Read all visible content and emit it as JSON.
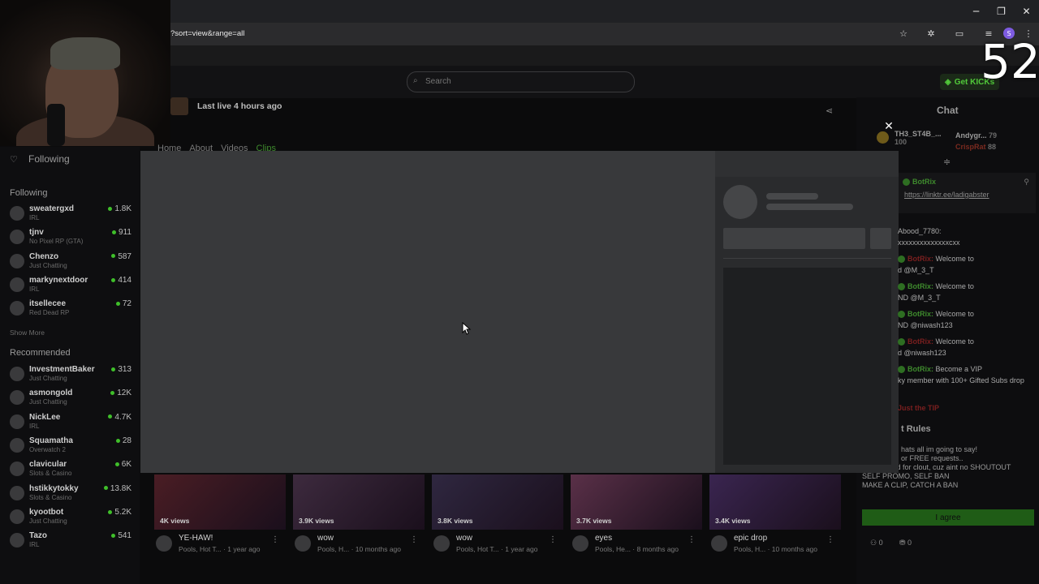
{
  "browser": {
    "url": "?sort=view&range=all",
    "profile_initial": "S",
    "win_minimize": "─",
    "win_restore": "❐",
    "win_close": "✕"
  },
  "overlay": {
    "viewer_number": "52"
  },
  "header": {
    "search_placeholder": "Search",
    "get_kicks_label": "Get KICKs"
  },
  "sidebar": {
    "following_title": "Following",
    "following_section": "Following",
    "following": [
      {
        "name": "sweatergxd",
        "category": "IRL",
        "viewers": "1.8K"
      },
      {
        "name": "tjnv",
        "category": "No Pixel RP (GTA)",
        "viewers": "911"
      },
      {
        "name": "Chenzo",
        "category": "Just Chatting",
        "viewers": "587"
      },
      {
        "name": "markynextdoor",
        "category": "IRL",
        "viewers": "414"
      },
      {
        "name": "itsellecee",
        "category": "Red Dead RP",
        "viewers": "72"
      }
    ],
    "show_more": "Show More",
    "recommended_section": "Recommended",
    "recommended": [
      {
        "name": "InvestmentBaker",
        "category": "Just Chatting",
        "viewers": "313"
      },
      {
        "name": "asmongold",
        "category": "Just Chatting",
        "viewers": "12K"
      },
      {
        "name": "NickLee",
        "category": "IRL",
        "viewers": "4.7K"
      },
      {
        "name": "Squamatha",
        "category": "Overwatch 2",
        "viewers": "28"
      },
      {
        "name": "clavicular",
        "category": "Slots & Casino",
        "viewers": "6K"
      },
      {
        "name": "hstikkytokky",
        "category": "Slots & Casino",
        "viewers": "13.8K"
      },
      {
        "name": "kyootbot",
        "category": "Just Chatting",
        "viewers": "5.2K"
      },
      {
        "name": "Tazo",
        "category": "IRL",
        "viewers": "541"
      }
    ]
  },
  "channel": {
    "last_live": "Last live 4 hours ago",
    "tabs": [
      "Home",
      "About",
      "Videos",
      "Clips"
    ],
    "active_tab": "Clips"
  },
  "clips": [
    {
      "views": "4K views",
      "title": "YE-HAW!",
      "sub": "Pools, Hot T... · 1 year ago",
      "color": "#4a1d24"
    },
    {
      "views": "3.9K views",
      "title": "wow",
      "sub": "Pools, H... · 10 months ago",
      "color": "#3d2a3e"
    },
    {
      "views": "3.8K views",
      "title": "wow",
      "sub": "Pools, Hot T... · 1 year ago",
      "color": "#2f2740"
    },
    {
      "views": "3.7K views",
      "title": "eyes",
      "sub": "Pools, He... · 8 months ago",
      "color": "#5a3048"
    },
    {
      "views": "3.4K views",
      "title": "epic drop",
      "sub": "Pools, H... · 10 months ago",
      "color": "#3a2550"
    }
  ],
  "chat": {
    "title": "Chat",
    "top_gifters": [
      {
        "name": "TH3_ST4B_...",
        "count": "100"
      },
      {
        "name": "Andygr...",
        "count": "79"
      },
      {
        "name": "CrispRat",
        "count": "88"
      }
    ],
    "pinned_user": "BotRix",
    "pinned_link": "https://linktr.ee/ladigabster",
    "lines": [
      {
        "user": "Abood_7780:",
        "text": "",
        "style": "plain"
      },
      {
        "user": "",
        "text": "xxxxxxxxxxxxxxcxx",
        "style": "plain"
      },
      {
        "user": "BotRix:",
        "text": "Welcome to",
        "style": "red"
      },
      {
        "user": "",
        "text": "d @M_3_T",
        "style": "plain"
      },
      {
        "user": "BotRix:",
        "text": "Welcome to",
        "style": "bot"
      },
      {
        "user": "",
        "text": "ND @M_3_T",
        "style": "plain"
      },
      {
        "user": "BotRix:",
        "text": "Welcome to",
        "style": "bot"
      },
      {
        "user": "",
        "text": "ND @niwash123",
        "style": "plain"
      },
      {
        "user": "BotRix:",
        "text": "Welcome to",
        "style": "red"
      },
      {
        "user": "",
        "text": "d @niwash123",
        "style": "plain"
      },
      {
        "user": "BotRix:",
        "text": "Become a VIP",
        "style": "bot"
      },
      {
        "user": "",
        "text": "ky member with 100+ Gifted Subs drop",
        "style": "plain"
      },
      {
        "user": "",
        "text": "Just the TIP",
        "style": "red"
      }
    ],
    "rules_title": "t Rules",
    "rules": [
      "hats all im going to say!",
      "or FREE requests..",
      "Do not Raid for clout, cuz aint no SHOUTOUT",
      "SELF PROMO, SELF BAN",
      "MAKE A CLIP, CATCH A BAN"
    ],
    "agree_label": "I agree",
    "footer_count_a": "0",
    "footer_count_b": "0"
  },
  "colors": {
    "accent_green": "#53fc18",
    "modal_bg": "#38393b"
  }
}
